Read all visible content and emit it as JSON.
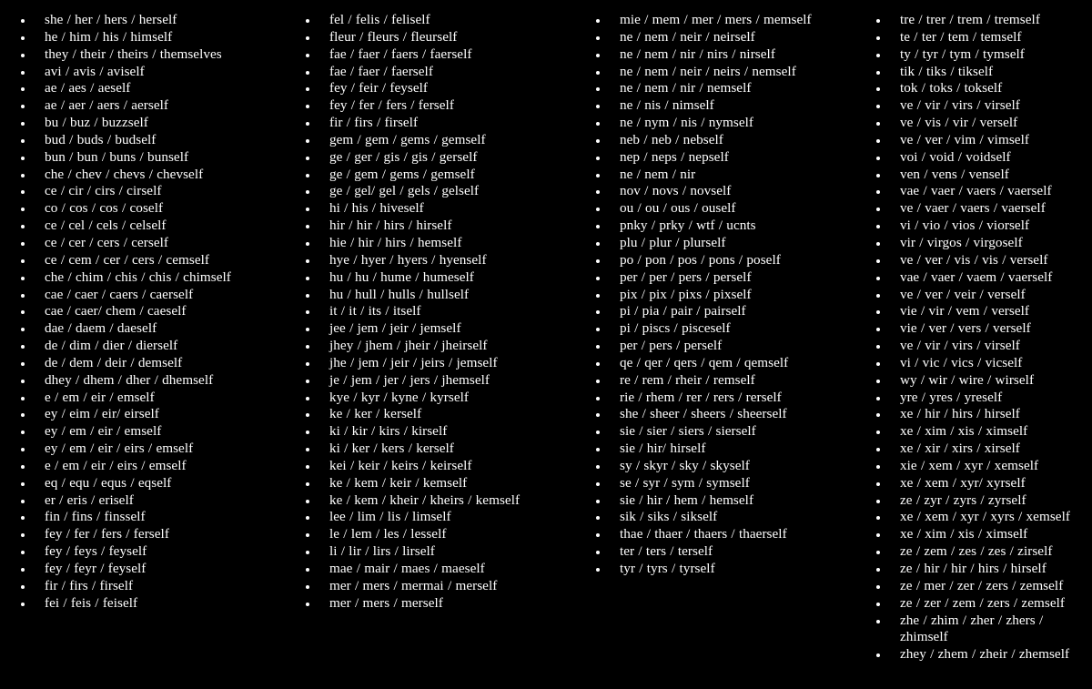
{
  "page": {
    "background_color": "#000000",
    "text_color": "#ffffff",
    "title": "Neopronoun list"
  },
  "columns": [
    {
      "name": "column-1",
      "items": [
        "she / her / hers / herself",
        "he / him / his / himself",
        "they / their / theirs / themselves",
        "avi / avis / aviself",
        "ae / aes / aeself",
        "ae / aer / aers / aerself",
        "bu / buz / buzzself",
        "bud / buds / budself",
        "bun / bun / buns / bunself",
        "che / chev / chevs / chevself",
        "ce / cir / cirs / cirself",
        "co / cos / cos / coself",
        "ce / cel / cels / celself",
        "ce / cer / cers / cerself",
        "ce / cem / cer / cers / cemself",
        "che / chim / chis / chis / chimself",
        "cae / caer / caers / caerself",
        "cae / caer/ chem / caeself",
        "dae / daem / daeself",
        "de / dim / dier / dierself",
        "de / dem / deir / demself",
        "dhey / dhem / dher / dhemself",
        "e / em / eir / emself",
        "ey / eim / eir/ eirself",
        "ey / em / eir / emself",
        "ey / em / eir / eirs / emself",
        "e / em / eir / eirs / emself",
        "eq / equ / equs / eqself",
        "er / eris / eriself",
        "fin / fins / finsself",
        "fey / fer / fers / ferself",
        "fey / feys / feyself",
        "fey / feyr / feyself",
        "fir / firs / firself",
        "fei / feis / feiself"
      ]
    },
    {
      "name": "column-2",
      "items": [
        "fel / felis / feliself",
        "fleur / fleurs / fleurself",
        "fae / faer / faers / faerself",
        "fae / faer / faerself",
        "fey / feir / feyself",
        "fey / fer / fers / ferself",
        "fir / firs / firself",
        "gem / gem / gems / gemself",
        "ge / ger / gis / gis / gerself",
        "ge / gem / gems / gemself",
        "ge / gel/ gel / gels / gelself",
        "hi / his / hiveself",
        "hir / hir / hirs / hirself",
        "hie / hir / hirs / hemself",
        "hye / hyer / hyers / hyenself",
        "hu / hu / hume / humeself",
        "hu / hull / hulls / hullself",
        "it / it / its / itself",
        "jee / jem / jeir / jemself",
        "jhey / jhem / jheir / jheirself",
        "jhe / jem / jeir / jeirs / jemself",
        "je / jem / jer / jers / jhemself",
        "kye / kyr / kyne / kyrself",
        "ke / ker / kerself",
        "ki / kir / kirs / kirself",
        "ki / ker / kers / kerself",
        "kei / keir / keirs / keirself",
        "ke / kem / keir / kemself",
        "ke / kem / kheir / kheirs / kemself",
        "lee / lim / lis / limself",
        "le / lem / les / lesself",
        "li / lir / lirs / lirself",
        "mae / mair / maes / maeself",
        "mer / mers / mermai / merself",
        "mer / mers / merself"
      ]
    },
    {
      "name": "column-3",
      "items": [
        "mie / mem / mer / mers / memself",
        "ne / nem / neir / neirself",
        "ne / nem / nir / nirs / nirself",
        "ne / nem / neir / neirs / nemself",
        "ne / nem / nir / nemself",
        "ne / nis / nimself",
        "ne / nym / nis / nymself",
        "neb / neb / nebself",
        "nep / neps / nepself",
        "ne / nem / nir",
        "nov / novs / novself",
        "ou / ou / ous / ouself",
        "pnky / prky / wtf / ucnts",
        "plu / plur / plurself",
        "po / pon / pos / pons / poself",
        "per / per / pers / perself",
        "pix / pix / pixs / pixself",
        "pi / pia / pair / pairself",
        "pi / piscs / pisceself",
        "per / pers / perself",
        "qe / qer / qers / qem / qemself",
        "re / rem / rheir / remself",
        "rie / rhem / rer / rers / rerself",
        "she / sheer / sheers / sheerself",
        "sie / sier / siers / sierself",
        "sie / hir/ hirself",
        "sy / skyr / sky / skyself",
        "se / syr / sym / symself",
        "sie / hir / hem / hemself",
        "sik / siks / sikself",
        "thae / thaer / thaers / thaerself",
        "ter / ters / terself",
        "tyr / tyrs / tyrself"
      ]
    },
    {
      "name": "column-4",
      "items": [
        "tre / trer / trem / tremself",
        "te / ter / tem / temself",
        "ty / tyr / tym / tymself",
        "tik / tiks / tikself",
        "tok / toks / tokself",
        "ve / vir / virs / virself",
        "ve / vis / vir / verself",
        "ve / ver / vim / vimself",
        "voi / void / voidself",
        "ven / vens / venself",
        "vae / vaer / vaers / vaerself",
        "ve / vaer / vaers / vaerself",
        "vi / vio / vios / viorself",
        "vir / virgos / virgoself",
        "ve / ver / vis / vis / verself",
        "vae / vaer / vaem / vaerself",
        "ve / ver / veir / verself",
        "vie / vir / vem / verself",
        "vie / ver / vers / verself",
        "ve / vir / virs / virself",
        "vi / vic / vics / vicself",
        "wy / wir / wire / wirself",
        "yre / yres / yreself",
        "xe / hir / hirs / hirself",
        "xe / xim / xis / ximself",
        "xe / xir / xirs / xirself",
        "xie / xem / xyr / xemself",
        "xe / xem / xyr/ xyrself",
        "ze / zyr / zyrs / zyrself",
        "xe / xem / xyr / xyrs / xemself",
        "xe / xim / xis / ximself",
        "ze / zem / zes / zes / zirself",
        "ze / hir / hir / hirs / hirself",
        "ze / mer / zer / zers / zemself",
        "ze / zer / zem / zers / zemself",
        "zhe / zhim / zher / zhers / zhimself",
        "zhey / zhem / zheir / zhemself"
      ]
    }
  ]
}
